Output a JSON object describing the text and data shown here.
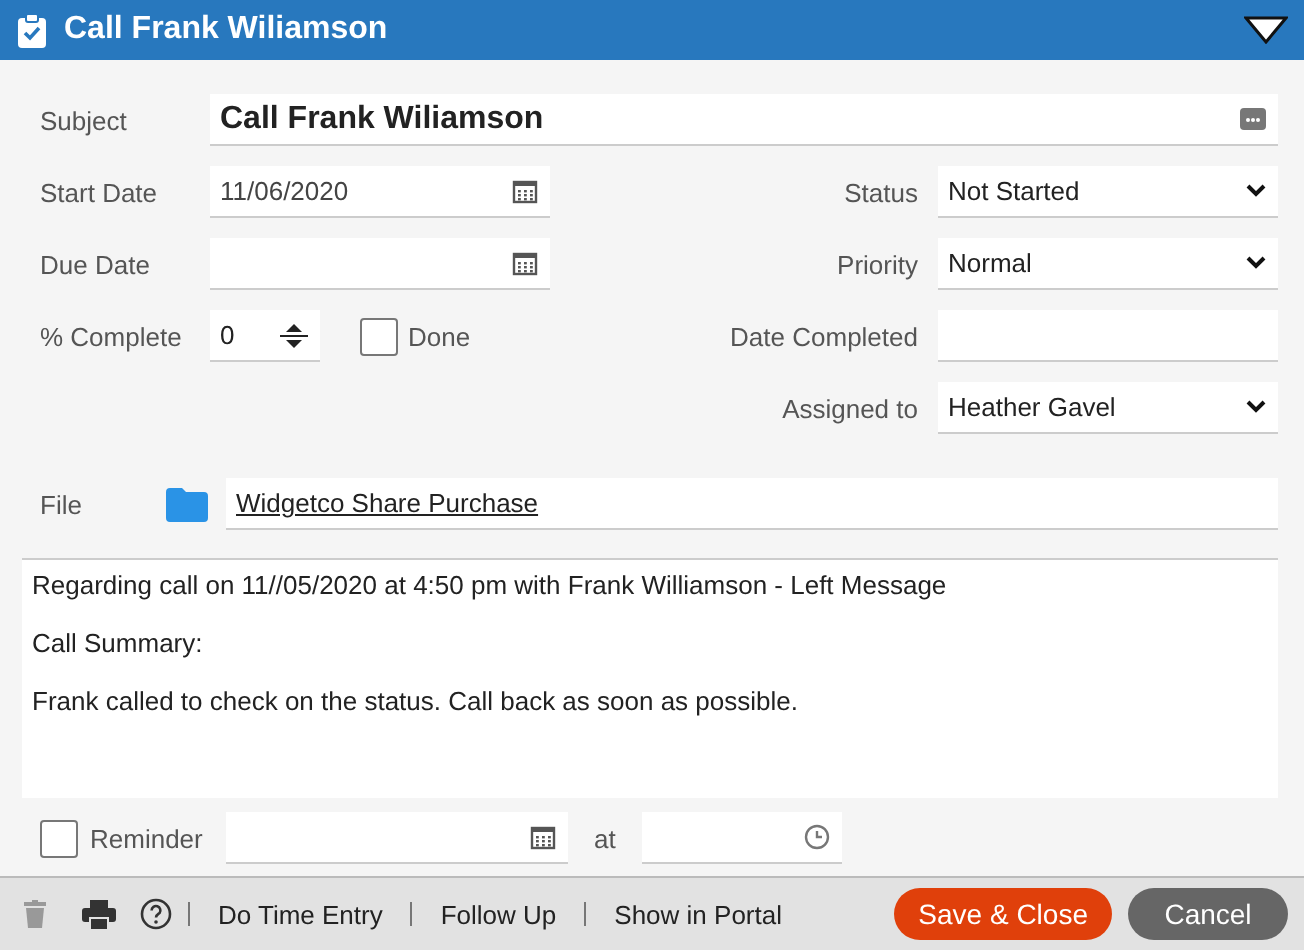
{
  "window": {
    "title": "Call Frank Wiliamson"
  },
  "subject": {
    "label": "Subject",
    "value": "Call Frank Wiliamson"
  },
  "start_date": {
    "label": "Start Date",
    "value": "11/06/2020"
  },
  "due_date": {
    "label": "Due Date"
  },
  "percent_complete": {
    "label": "% Complete",
    "value": "0"
  },
  "done": {
    "label": "Done",
    "checked": false
  },
  "status": {
    "label": "Status",
    "value": "Not Started"
  },
  "priority": {
    "label": "Priority",
    "value": "Normal"
  },
  "date_completed": {
    "label": "Date Completed"
  },
  "assigned_to": {
    "label": "Assigned to",
    "value": "Heather Gavel"
  },
  "file": {
    "label": "File",
    "value": "Widgetco Share Purchase"
  },
  "notes": [
    "Regarding call on 11//05/2020 at 4:50 pm with Frank Williamson - Left Message",
    "Call Summary:",
    "Frank called to check on the status. Call back as soon as possible."
  ],
  "reminder": {
    "label": "Reminder",
    "checked": false,
    "at_label": "at"
  },
  "footer": {
    "links": [
      "Do Time Entry",
      "Follow Up",
      "Show in Portal"
    ],
    "buttons": [
      {
        "label": "Save & Close",
        "kind": "primary"
      },
      {
        "label": "Cancel",
        "kind": "secondary"
      }
    ]
  }
}
